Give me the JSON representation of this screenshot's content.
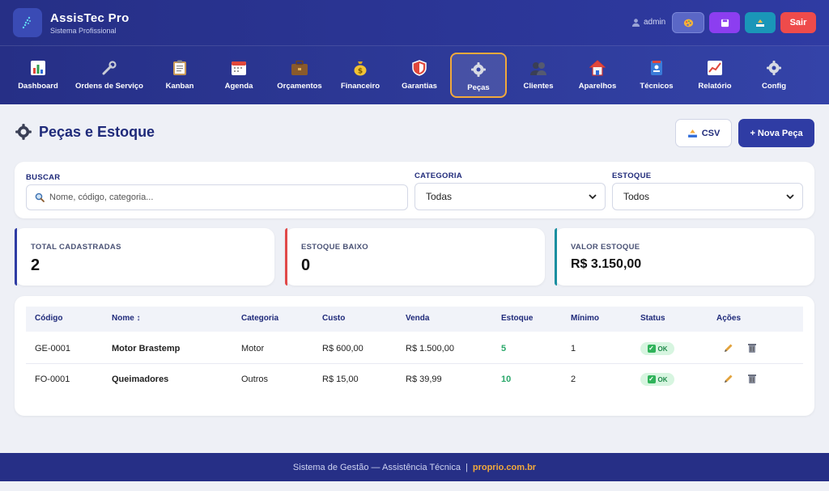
{
  "app": {
    "title": "AssisTec Pro",
    "subtitle": "Sistema Profissional"
  },
  "header": {
    "user": "admin",
    "logout_label": "Sair"
  },
  "nav": [
    {
      "label": "Dashboard",
      "icon": "chart-icon"
    },
    {
      "label": "Ordens de Serviço",
      "icon": "wrench-icon"
    },
    {
      "label": "Kanban",
      "icon": "clipboard-icon"
    },
    {
      "label": "Agenda",
      "icon": "calendar-icon"
    },
    {
      "label": "Orçamentos",
      "icon": "briefcase-icon"
    },
    {
      "label": "Financeiro",
      "icon": "money-bag-icon"
    },
    {
      "label": "Garantias",
      "icon": "shield-icon"
    },
    {
      "label": "Peças",
      "icon": "gear-icon",
      "active": true
    },
    {
      "label": "Clientes",
      "icon": "users-icon"
    },
    {
      "label": "Aparelhos",
      "icon": "house-icon"
    },
    {
      "label": "Técnicos",
      "icon": "technician-icon"
    },
    {
      "label": "Relatório",
      "icon": "line-chart-icon"
    },
    {
      "label": "Config",
      "icon": "gear-icon"
    }
  ],
  "page": {
    "title": "Peças e Estoque",
    "csv_label": "CSV",
    "new_label": "+ Nova Peça"
  },
  "filters": {
    "search_label": "BUSCAR",
    "search_placeholder": "Nome, código, categoria...",
    "category_label": "CATEGORIA",
    "category_value": "Todas",
    "stock_label": "ESTOQUE",
    "stock_value": "Todos"
  },
  "stats": [
    {
      "label": "TOTAL CADASTRADAS",
      "value": "2",
      "color": "#2f3ca4"
    },
    {
      "label": "ESTOQUE BAIXO",
      "value": "0",
      "color": "#e04848"
    },
    {
      "label": "VALOR ESTOQUE",
      "value": "R$ 3.150,00",
      "color": "#1a8fa0"
    }
  ],
  "table": {
    "headers": [
      "Código",
      "Nome ↕",
      "Categoria",
      "Custo",
      "Venda",
      "Estoque",
      "Mínimo",
      "Status",
      "Ações"
    ],
    "rows": [
      {
        "code": "GE-0001",
        "name": "Motor Brastemp",
        "category": "Motor",
        "cost": "R$ 600,00",
        "price": "R$ 1.500,00",
        "stock": "5",
        "min": "1",
        "status": "OK"
      },
      {
        "code": "FO-0001",
        "name": "Queimadores",
        "category": "Outros",
        "cost": "R$ 15,00",
        "price": "R$ 39,99",
        "stock": "10",
        "min": "2",
        "status": "OK"
      }
    ]
  },
  "footer": {
    "text": "Sistema de Gestão — Assistência Técnica",
    "separator": "|",
    "link": "proprio.com.br"
  },
  "colors": {
    "primary": "#2f3ca4",
    "accent": "#f2a93b",
    "ok": "#2fb35a",
    "stock_green": "#2aa86a"
  }
}
